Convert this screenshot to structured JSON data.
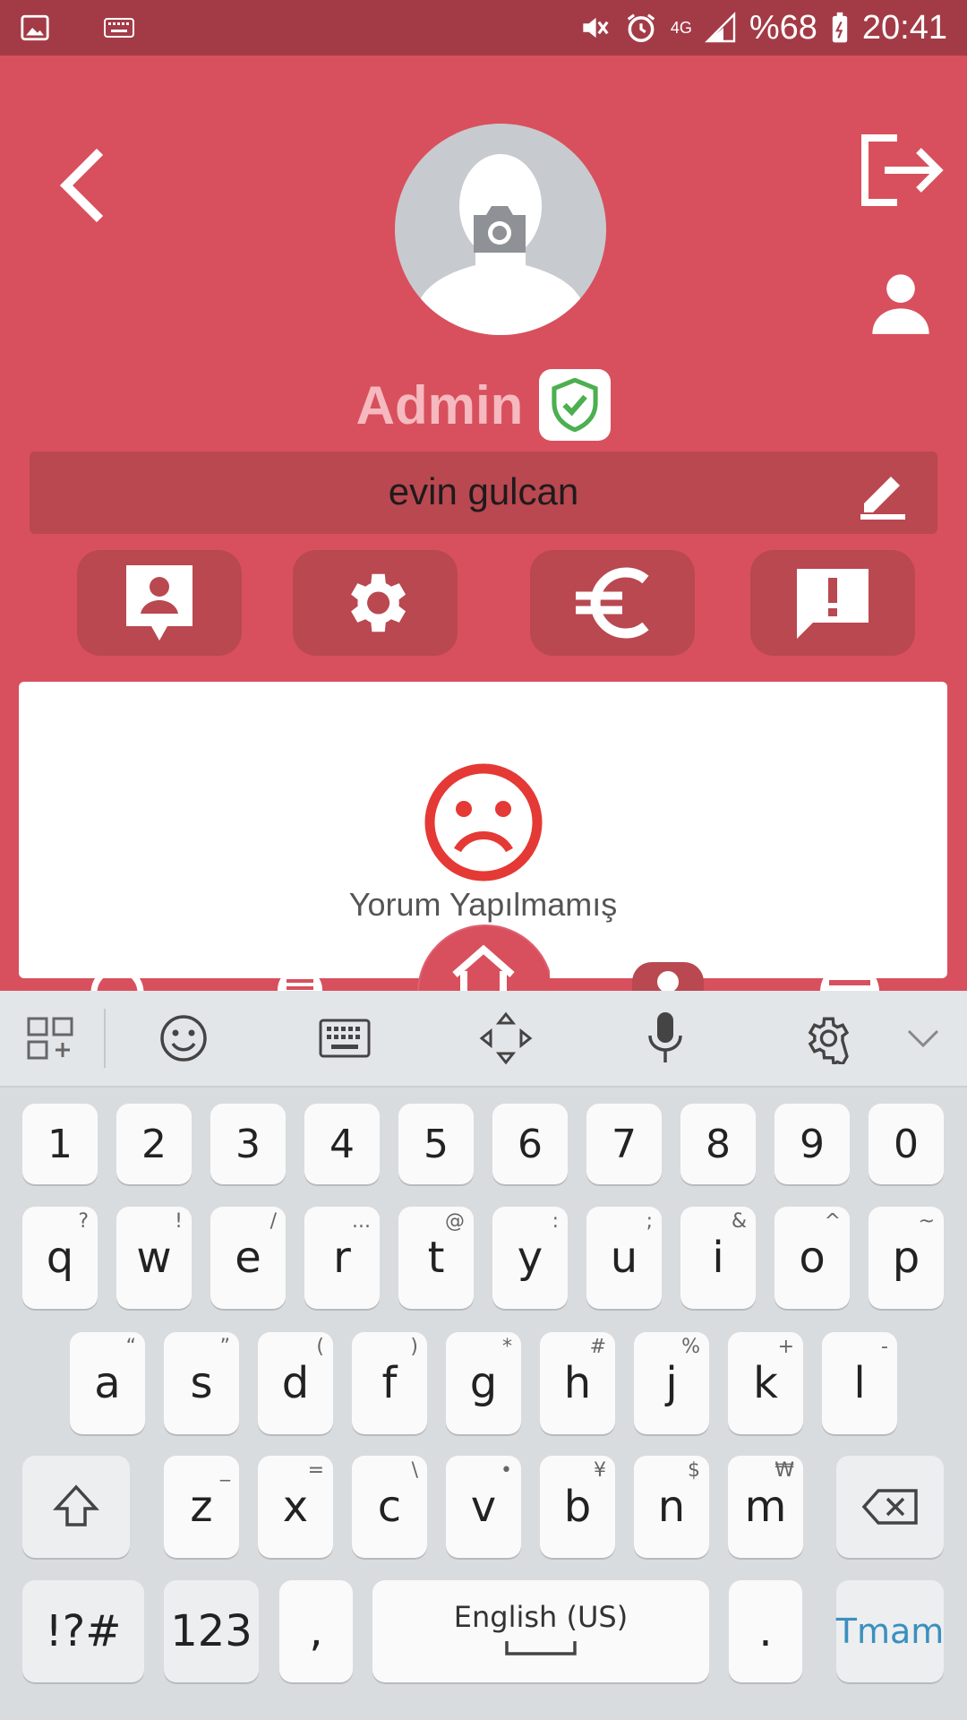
{
  "status_bar": {
    "battery": "%68",
    "time": "20:41",
    "network": "4G"
  },
  "profile": {
    "role": "Admin",
    "name": "evin gulcan",
    "empty_message": "Yorum Yapılmamış"
  },
  "keyboard": {
    "number_row": [
      "1",
      "2",
      "3",
      "4",
      "5",
      "6",
      "7",
      "8",
      "9",
      "0"
    ],
    "row1": [
      {
        "k": "q",
        "h": "?"
      },
      {
        "k": "w",
        "h": "!"
      },
      {
        "k": "e",
        "h": "/"
      },
      {
        "k": "r",
        "h": "..."
      },
      {
        "k": "t",
        "h": "@"
      },
      {
        "k": "y",
        "h": ":"
      },
      {
        "k": "u",
        "h": ";"
      },
      {
        "k": "i",
        "h": "&"
      },
      {
        "k": "o",
        "h": "^"
      },
      {
        "k": "p",
        "h": "~"
      }
    ],
    "row2": [
      {
        "k": "a",
        "h": "“"
      },
      {
        "k": "s",
        "h": "”"
      },
      {
        "k": "d",
        "h": "("
      },
      {
        "k": "f",
        "h": ")"
      },
      {
        "k": "g",
        "h": "*"
      },
      {
        "k": "h",
        "h": "#"
      },
      {
        "k": "j",
        "h": "%"
      },
      {
        "k": "k",
        "h": "+"
      },
      {
        "k": "l",
        "h": "-"
      }
    ],
    "row3": [
      {
        "k": "z",
        "h": "_"
      },
      {
        "k": "x",
        "h": "="
      },
      {
        "k": "c",
        "h": "\\"
      },
      {
        "k": "v",
        "h": "•"
      },
      {
        "k": "b",
        "h": "¥"
      },
      {
        "k": "n",
        "h": "$"
      },
      {
        "k": "m",
        "h": "₩"
      }
    ],
    "symbols_label": "!?#",
    "numbers_label": "123",
    "comma": ",",
    "space_label": "English (US)",
    "period": ".",
    "done_label": "Tmam",
    "done_color": "#3a8fbf"
  },
  "colors": {
    "primary": "#d8505d",
    "statusbar": "#a33b46",
    "button_bg": "#b94850",
    "verified": "#4caf50",
    "sad_icon": "#e53935"
  },
  "icons": [
    "gallery-icon",
    "keyboard-icon",
    "mute-icon",
    "alarm-icon",
    "signal-icon",
    "battery-icon",
    "back-icon",
    "logout-icon",
    "profile-icon",
    "camera-icon",
    "verified-shield-icon",
    "edit-icon",
    "contact-card-icon",
    "settings-icon",
    "euro-icon",
    "report-icon",
    "sad-face-icon",
    "home-icon"
  ]
}
